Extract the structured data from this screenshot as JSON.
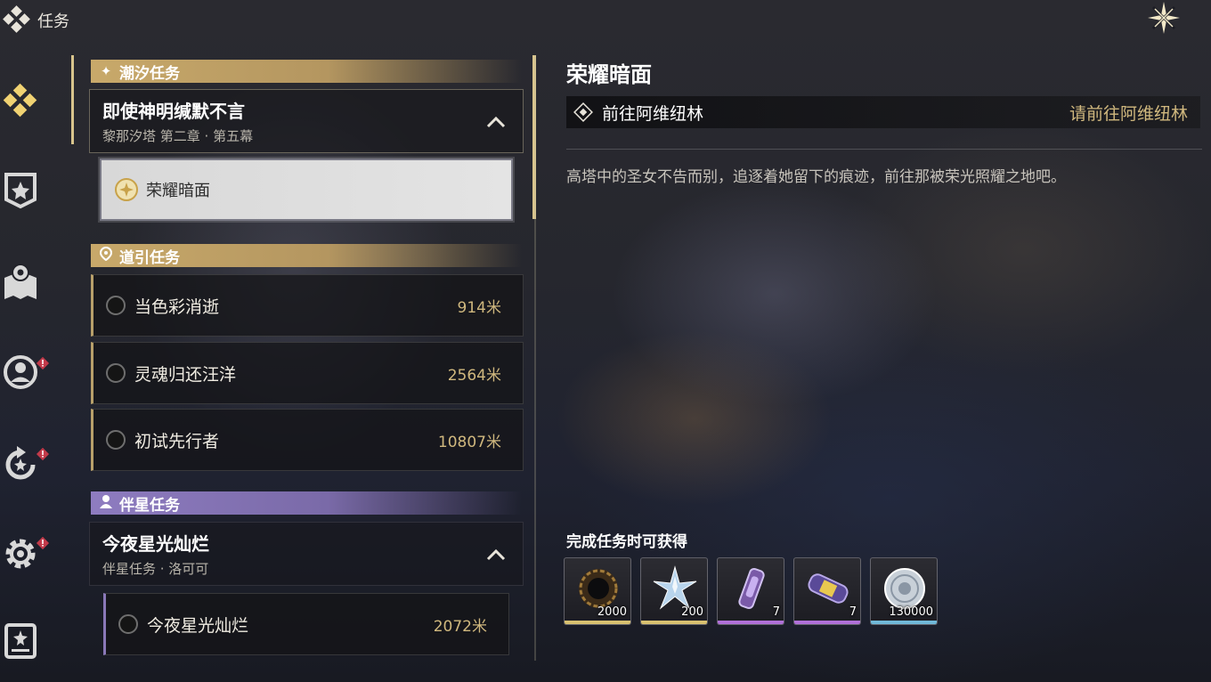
{
  "topbar": {
    "title": "任务",
    "close_icon": "close-sparkle-icon"
  },
  "rail": [
    {
      "name": "quest-tab-icon",
      "alert": false
    },
    {
      "name": "badge-flag-icon",
      "alert": false
    },
    {
      "name": "map-pin-icon",
      "alert": false
    },
    {
      "name": "compass-person-icon",
      "alert": true
    },
    {
      "name": "refresh-cycle-icon",
      "alert": true
    },
    {
      "name": "settings-gear-icon",
      "alert": true
    },
    {
      "name": "journal-book-icon",
      "alert": false
    }
  ],
  "categories": {
    "tide": {
      "label": "潮汐任务",
      "icon": "sparkle-icon",
      "color": "#c8a96a"
    },
    "guide": {
      "label": "道引任务",
      "icon": "location-pin-icon",
      "color": "#c8a96a"
    },
    "companion": {
      "label": "伴星任务",
      "icon": "person-icon",
      "color": "#8e7cc0"
    }
  },
  "tide_chapter": {
    "title": "即使神明缄默不言",
    "subtitle": "黎那汐塔 第二章 · 第五幕"
  },
  "tide_selected": {
    "label": "荣耀暗面"
  },
  "guide_tasks": [
    {
      "name": "当色彩消逝",
      "distance": "914米"
    },
    {
      "name": "灵魂归还汪洋",
      "distance": "2564米"
    },
    {
      "name": "初试先行者",
      "distance": "10807米"
    }
  ],
  "companion_chapter": {
    "title": "今夜星光灿烂",
    "subtitle": "伴星任务 · 洛可可"
  },
  "companion_tasks": [
    {
      "name": "今夜星光灿烂",
      "distance": "2072米"
    }
  ],
  "detail": {
    "title": "荣耀暗面",
    "objective": "前往阿维纽林",
    "objective_hint": "请前往阿维纽林",
    "description": "高塔中的圣女不告而别，追逐着她留下的痕迹，前往那被荣光照耀之地吧。"
  },
  "rewards": {
    "title": "完成任务时可获得",
    "items": [
      {
        "icon": "dark-ring-icon",
        "qty": "2000",
        "rarity_color": "#d8c070"
      },
      {
        "icon": "crystal-star-icon",
        "qty": "200",
        "rarity_color": "#d8c070"
      },
      {
        "icon": "purple-tube-icon",
        "qty": "7",
        "rarity_color": "#b070d8"
      },
      {
        "icon": "purple-capsule-icon",
        "qty": "7",
        "rarity_color": "#b070d8"
      },
      {
        "icon": "silver-coin-icon",
        "qty": "130000",
        "rarity_color": "#70b8d8"
      }
    ]
  }
}
